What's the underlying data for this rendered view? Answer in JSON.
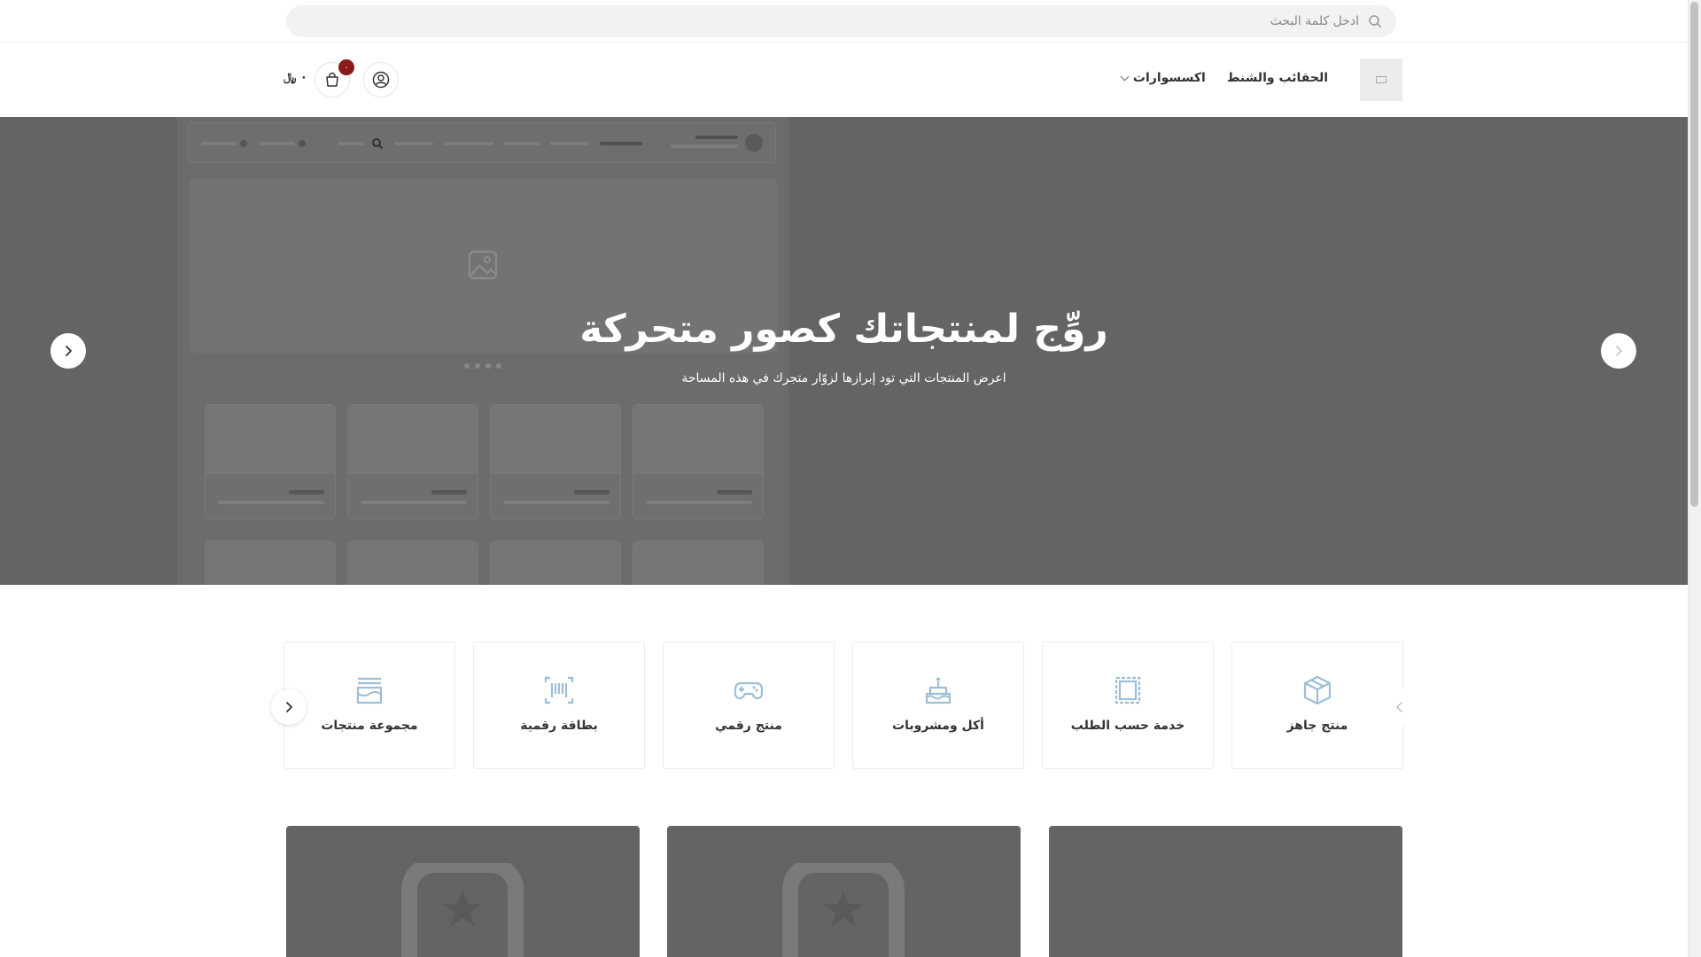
{
  "search": {
    "placeholder": "ادخل كلمة البحث"
  },
  "header": {
    "logo_name": "store-logo",
    "nav": [
      {
        "label": "الحقائب والشنط"
      },
      {
        "label": "اكسسوارات",
        "has_dropdown": true
      }
    ],
    "cart": {
      "count": "٠",
      "total": "٠ ﷼"
    }
  },
  "hero": {
    "title": "روِّج لمنتجاتك كصور متحركة",
    "subtitle": "اعرض المنتجات التي تود إبرازها لزوّار متجرك في هذه المساحة",
    "background": "#646464"
  },
  "categories": [
    {
      "label": "منتج جاهز",
      "icon": "box-icon"
    },
    {
      "label": "خدمة حسب الطلب",
      "icon": "ticket-icon"
    },
    {
      "label": "أكل ومشروبات",
      "icon": "cake-icon"
    },
    {
      "label": "منتج رقمي",
      "icon": "gamepad-icon"
    },
    {
      "label": "بطاقة رقمية",
      "icon": "barcode-icon"
    },
    {
      "label": "مجموعة منتجات",
      "icon": "stack-icon"
    }
  ],
  "colors": {
    "accent": "#8b1a1a",
    "icon_blue": "#9dbfd6",
    "hero_bg": "#646464"
  }
}
